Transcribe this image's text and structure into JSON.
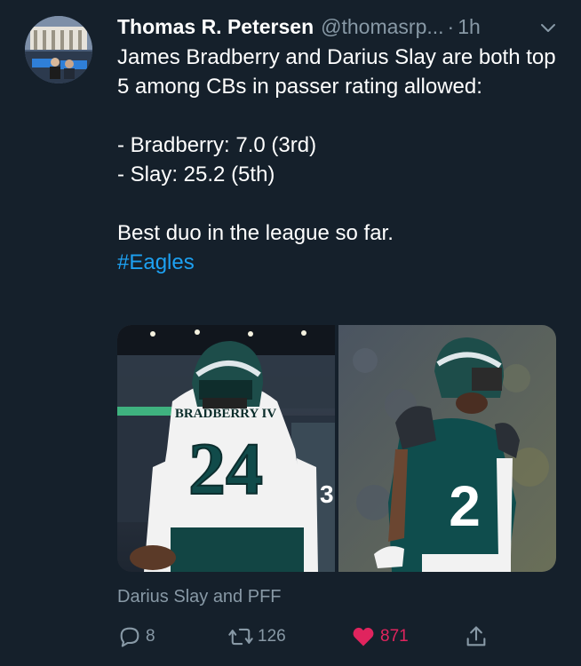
{
  "tweet": {
    "author_name": "Thomas R. Petersen",
    "handle": "@thomasrp...",
    "dot": "·",
    "time": "1h",
    "line1": "James Bradberry and Darius Slay are both top 5 among CBs in passer rating allowed:",
    "line2": "- Bradberry: 7.0 (3rd)",
    "line3": "- Slay: 25.2 (5th)",
    "line4": "Best duo in the league so far.",
    "hashtag": "#Eagles",
    "media_left": {
      "nameplate": "BRADBERRY IV",
      "number": "24"
    },
    "media_right": {
      "number": "2"
    },
    "caption": "Darius Slay and PFF"
  },
  "actions": {
    "reply_count": "8",
    "retweet_count": "126",
    "like_count": "871"
  },
  "icons": {
    "reply": "reply-icon",
    "retweet": "retweet-icon",
    "like": "heart-icon",
    "share": "share-icon",
    "more": "chevron-down-icon"
  },
  "colors": {
    "background": "#15202b",
    "secondary_text": "#8899a6",
    "link": "#1da1f2",
    "like": "#e0245e"
  }
}
